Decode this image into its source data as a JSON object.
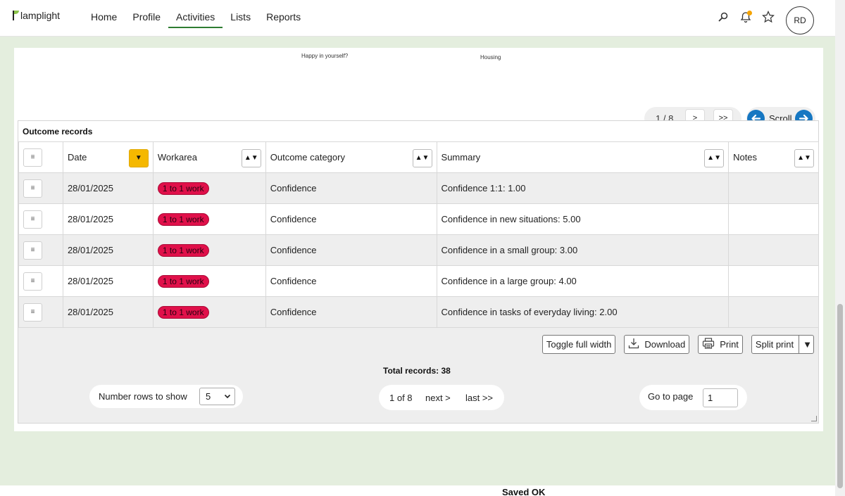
{
  "app": {
    "logo_text": "lamplight"
  },
  "nav": {
    "items": [
      {
        "label": "Home"
      },
      {
        "label": "Profile"
      },
      {
        "label": "Activities"
      },
      {
        "label": "Lists"
      },
      {
        "label": "Reports"
      }
    ],
    "active": "Activities"
  },
  "user": {
    "initials": "RD"
  },
  "chart": {
    "labels": [
      "Happy in yourself?",
      "Housing"
    ]
  },
  "top_pager": {
    "count": "1 / 8",
    "next": ">",
    "last": ">>"
  },
  "scroll": {
    "label": "Scroll"
  },
  "records": {
    "title": "Outcome records",
    "columns": [
      "Date",
      "Workarea",
      "Outcome category",
      "Summary",
      "Notes"
    ],
    "rows": [
      {
        "date": "28/01/2025",
        "workarea": "1 to 1 work",
        "category": "Confidence",
        "summary": "Confidence 1:1: 1.00",
        "notes": ""
      },
      {
        "date": "28/01/2025",
        "workarea": "1 to 1 work",
        "category": "Confidence",
        "summary": "Confidence in new situations: 5.00",
        "notes": ""
      },
      {
        "date": "28/01/2025",
        "workarea": "1 to 1 work",
        "category": "Confidence",
        "summary": "Confidence in a small group: 3.00",
        "notes": ""
      },
      {
        "date": "28/01/2025",
        "workarea": "1 to 1 work",
        "category": "Confidence",
        "summary": "Confidence in a large group: 4.00",
        "notes": ""
      },
      {
        "date": "28/01/2025",
        "workarea": "1 to 1 work",
        "category": "Confidence",
        "summary": "Confidence in tasks of everyday living: 2.00",
        "notes": ""
      }
    ],
    "menu_glyph": "≡",
    "sort_glyph": "▲▼",
    "sort_active_glyph": "▼",
    "tag_color": "#e0104a"
  },
  "actions": {
    "toggle": "Toggle full width",
    "download": "Download",
    "print": "Print",
    "split_print": "Split print",
    "split_arrow": "▼"
  },
  "total": "Total records: 38",
  "rows_to_show": {
    "label": "Number rows to show",
    "value": "5"
  },
  "pagination": {
    "current": "1 of 8",
    "next": "next >",
    "last": "last >>"
  },
  "goto": {
    "label": "Go to page",
    "value": "1"
  },
  "status": {
    "saved": "Saved OK"
  },
  "colors": {
    "accent": "#2e7d32",
    "scroll_arrow": "#1677c2",
    "sort_active": "#f5b800",
    "page_bg": "#e4eede"
  }
}
